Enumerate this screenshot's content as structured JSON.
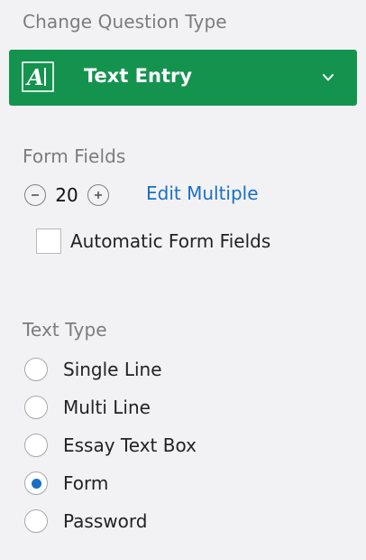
{
  "change_question_type": {
    "title": "Change Question Type",
    "selected_label": "Text Entry",
    "icon": "text-entry-icon",
    "accent_color": "#14934f"
  },
  "form_fields": {
    "title": "Form Fields",
    "count": "20",
    "edit_multiple_label": "Edit Multiple",
    "automatic_label": "Automatic Form Fields",
    "automatic_checked": false
  },
  "text_type": {
    "title": "Text Type",
    "options": [
      {
        "label": "Single Line",
        "selected": false
      },
      {
        "label": "Multi Line",
        "selected": false
      },
      {
        "label": "Essay Text Box",
        "selected": false
      },
      {
        "label": "Form",
        "selected": true
      },
      {
        "label": "Password",
        "selected": false
      }
    ],
    "selected_color": "#1a6fc4"
  }
}
